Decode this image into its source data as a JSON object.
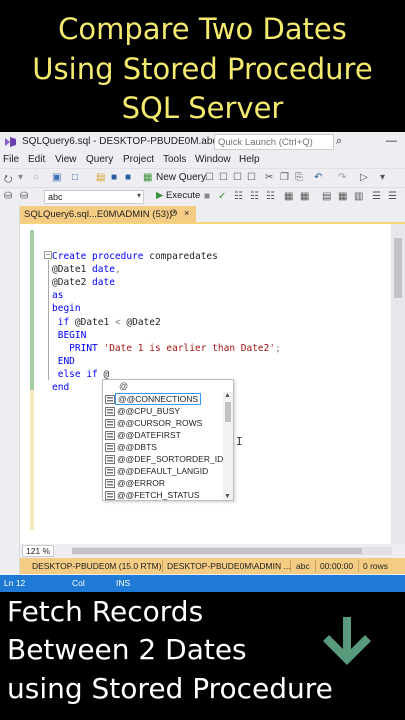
{
  "banner_top": {
    "line1": "Compare Two Dates",
    "line2": "Using Stored Procedure",
    "line3": "SQL Server"
  },
  "window": {
    "title": "SQLQuery6.sql - DESKTOP-PBUDE0M.abc (DE...",
    "quick_launch_placeholder": "Quick Launch (Ctrl+Q)",
    "search_glyph": "⌕",
    "minimize_glyph": "—"
  },
  "menu": [
    "File",
    "Edit",
    "View",
    "Query",
    "Project",
    "Tools",
    "Window",
    "Help"
  ],
  "toolbar": {
    "new_query_label": "New Query",
    "database_value": "abc",
    "execute_label": "Execute"
  },
  "tab": {
    "label": "SQLQuery6.sql...E0M\\ADMIN (53))*",
    "pin_glyph": "⭘",
    "close_glyph": "×"
  },
  "code": [
    {
      "parts": [
        {
          "t": "Create procedure ",
          "c": "kw"
        },
        {
          "t": "comparedates",
          "c": ""
        }
      ]
    },
    {
      "parts": [
        {
          "t": "@Date1 ",
          "c": ""
        },
        {
          "t": "date",
          "c": "kw"
        },
        {
          "t": ",",
          "c": "op"
        }
      ]
    },
    {
      "parts": [
        {
          "t": "@Date2 ",
          "c": ""
        },
        {
          "t": "date",
          "c": "kw"
        }
      ]
    },
    {
      "parts": [
        {
          "t": "as",
          "c": "kw"
        }
      ]
    },
    {
      "parts": [
        {
          "t": "begin",
          "c": "kw"
        }
      ]
    },
    {
      "parts": [
        {
          "t": " if ",
          "c": "kw"
        },
        {
          "t": "@Date1 ",
          "c": ""
        },
        {
          "t": "< ",
          "c": "op"
        },
        {
          "t": "@Date2",
          "c": ""
        }
      ]
    },
    {
      "parts": [
        {
          "t": " BEGIN",
          "c": "kw"
        }
      ]
    },
    {
      "parts": [
        {
          "t": "   PRINT ",
          "c": "kw"
        },
        {
          "t": "'Date 1 is earlier than Date2'",
          "c": "str"
        },
        {
          "t": ";",
          "c": "op"
        }
      ]
    },
    {
      "parts": [
        {
          "t": " END",
          "c": "kw"
        }
      ]
    },
    {
      "parts": [
        {
          "t": " else if ",
          "c": "kw"
        },
        {
          "t": "@",
          "c": ""
        }
      ]
    },
    {
      "parts": [
        {
          "t": "end",
          "c": "kw"
        }
      ]
    }
  ],
  "autocomplete": {
    "typed": "@",
    "items": [
      "@@CONNECTIONS",
      "@@CPU_BUSY",
      "@@CURSOR_ROWS",
      "@@DATEFIRST",
      "@@DBTS",
      "@@DEF_SORTORDER_ID",
      "@@DEFAULT_LANGID",
      "@@ERROR",
      "@@FETCH_STATUS"
    ]
  },
  "zoom": "121 %",
  "connection_bar": {
    "server": "DESKTOP-PBUDE0M (15.0 RTM)",
    "user": "DESKTOP-PBUDE0M\\ADMIN ...",
    "database": "abc",
    "elapsed": "00:00:00",
    "rows": "0 rows"
  },
  "status": {
    "ln": "Ln 12",
    "col": "Col",
    "ins": "INS"
  },
  "banner_bottom": {
    "line1": "Fetch Records",
    "line2": "Between 2 Dates",
    "line3": "using Stored Procedure"
  },
  "colors": {
    "banner_top_text": "#f3ea6e",
    "arrow": "#5a9a7c",
    "tab_active": "#f5cc84",
    "status_blue": "#1e7ad4"
  }
}
